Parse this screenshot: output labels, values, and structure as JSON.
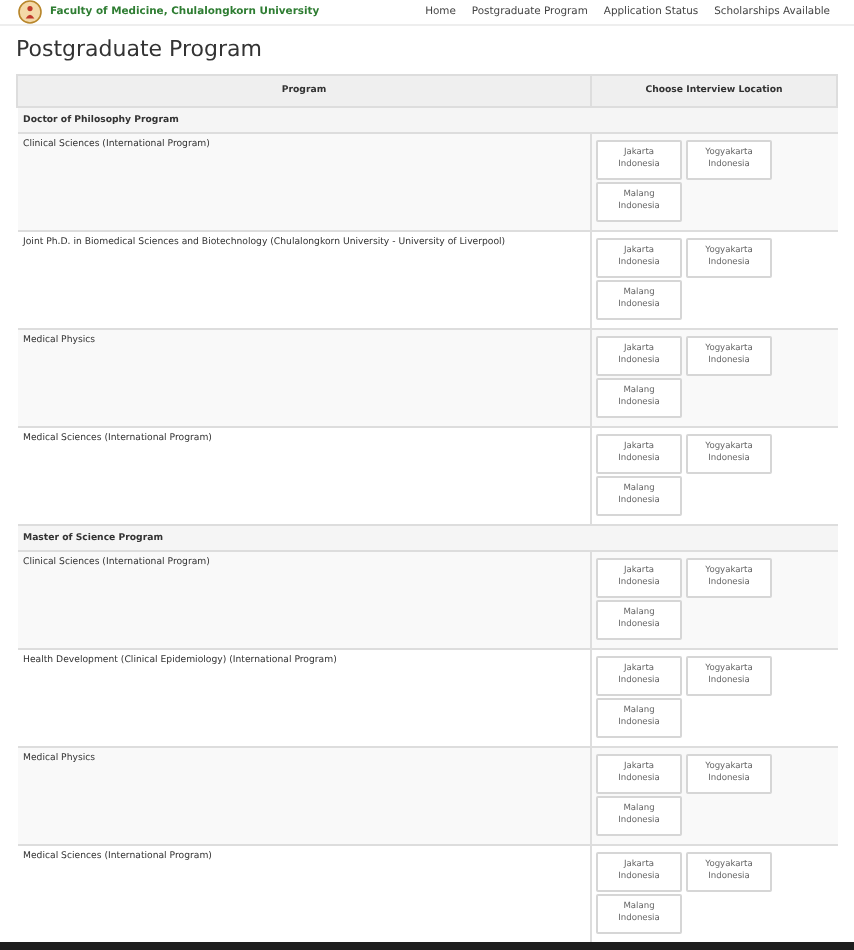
{
  "navbar": {
    "brand": "Faculty of Medicine, Chulalongkorn University",
    "links": [
      "Home",
      "Postgraduate Program",
      "Application Status",
      "Scholarships Available"
    ]
  },
  "page_title": "Postgraduate Program",
  "table": {
    "columns": [
      "Program",
      "Choose Interview Location"
    ],
    "sections": [
      {
        "title": "Doctor of Philosophy Program",
        "programs": [
          {
            "name": "Clinical Sciences (International Program)",
            "locations": [
              {
                "city": "Jakarta",
                "country": "Indonesia"
              },
              {
                "city": "Yogyakarta",
                "country": "Indonesia"
              },
              {
                "city": "Malang",
                "country": "Indonesia"
              }
            ]
          },
          {
            "name": "Joint Ph.D. in Biomedical Sciences and Biotechnology (Chulalongkorn University - University of Liverpool)",
            "locations": [
              {
                "city": "Jakarta",
                "country": "Indonesia"
              },
              {
                "city": "Yogyakarta",
                "country": "Indonesia"
              },
              {
                "city": "Malang",
                "country": "Indonesia"
              }
            ]
          },
          {
            "name": "Medical Physics",
            "locations": [
              {
                "city": "Jakarta",
                "country": "Indonesia"
              },
              {
                "city": "Yogyakarta",
                "country": "Indonesia"
              },
              {
                "city": "Malang",
                "country": "Indonesia"
              }
            ]
          },
          {
            "name": "Medical Sciences (International Program)",
            "locations": [
              {
                "city": "Jakarta",
                "country": "Indonesia"
              },
              {
                "city": "Yogyakarta",
                "country": "Indonesia"
              },
              {
                "city": "Malang",
                "country": "Indonesia"
              }
            ]
          }
        ]
      },
      {
        "title": "Master of Science Program",
        "programs": [
          {
            "name": "Clinical Sciences (International Program)",
            "locations": [
              {
                "city": "Jakarta",
                "country": "Indonesia"
              },
              {
                "city": "Yogyakarta",
                "country": "Indonesia"
              },
              {
                "city": "Malang",
                "country": "Indonesia"
              }
            ]
          },
          {
            "name": "Health Development (Clinical Epidemiology) (International Program)",
            "locations": [
              {
                "city": "Jakarta",
                "country": "Indonesia"
              },
              {
                "city": "Yogyakarta",
                "country": "Indonesia"
              },
              {
                "city": "Malang",
                "country": "Indonesia"
              }
            ]
          },
          {
            "name": "Medical Physics",
            "locations": [
              {
                "city": "Jakarta",
                "country": "Indonesia"
              },
              {
                "city": "Yogyakarta",
                "country": "Indonesia"
              },
              {
                "city": "Malang",
                "country": "Indonesia"
              }
            ]
          },
          {
            "name": "Medical Sciences (International Program)",
            "locations": [
              {
                "city": "Jakarta",
                "country": "Indonesia"
              },
              {
                "city": "Yogyakarta",
                "country": "Indonesia"
              },
              {
                "city": "Malang",
                "country": "Indonesia"
              }
            ]
          }
        ]
      }
    ]
  }
}
